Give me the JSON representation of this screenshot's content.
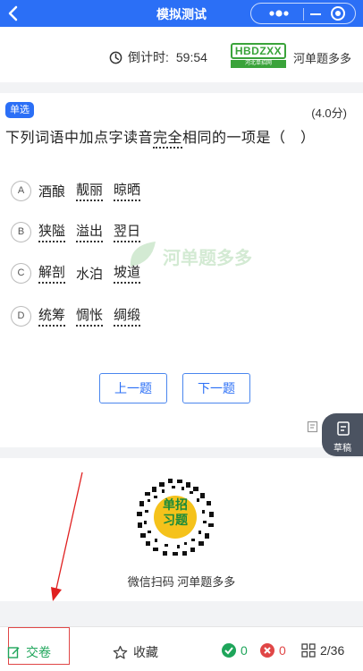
{
  "header": {
    "title": "模拟测试"
  },
  "timer": {
    "label": "倒计时:",
    "value": "59:54"
  },
  "brand": {
    "logo_text": "HBDZXX",
    "logo_sub": "河北单招网",
    "name": "河单题多多"
  },
  "question": {
    "type_badge": "单选",
    "score": "(4.0分)",
    "stem_before": "下列词语中加点字读音",
    "stem_emphasis": "完全",
    "stem_after": "相同的一项是（　）",
    "options": [
      {
        "letter": "A",
        "words": [
          "酒酿",
          "靓丽",
          "晾晒"
        ]
      },
      {
        "letter": "B",
        "words": [
          "狭隘",
          "溢出",
          "翌日"
        ]
      },
      {
        "letter": "C",
        "words": [
          "解剖",
          "水泊",
          "坡道"
        ]
      },
      {
        "letter": "D",
        "words": [
          "统筹",
          "惆怅",
          "绸缎"
        ]
      }
    ],
    "watermark": "河单题多多"
  },
  "nav": {
    "prev": "上一题",
    "next": "下一题"
  },
  "draft": {
    "label": "草稿"
  },
  "qr": {
    "center_line1": "单招",
    "center_line2": "习题",
    "caption": "微信扫码 河单题多多"
  },
  "bottom": {
    "submit": "交卷",
    "favorite": "收藏",
    "correct_count": "0",
    "wrong_count": "0",
    "progress": "2/36"
  },
  "colors": {
    "primary": "#2b6ff6",
    "correct": "#1ea55a",
    "wrong": "#e04646",
    "annotation": "#e02020"
  }
}
